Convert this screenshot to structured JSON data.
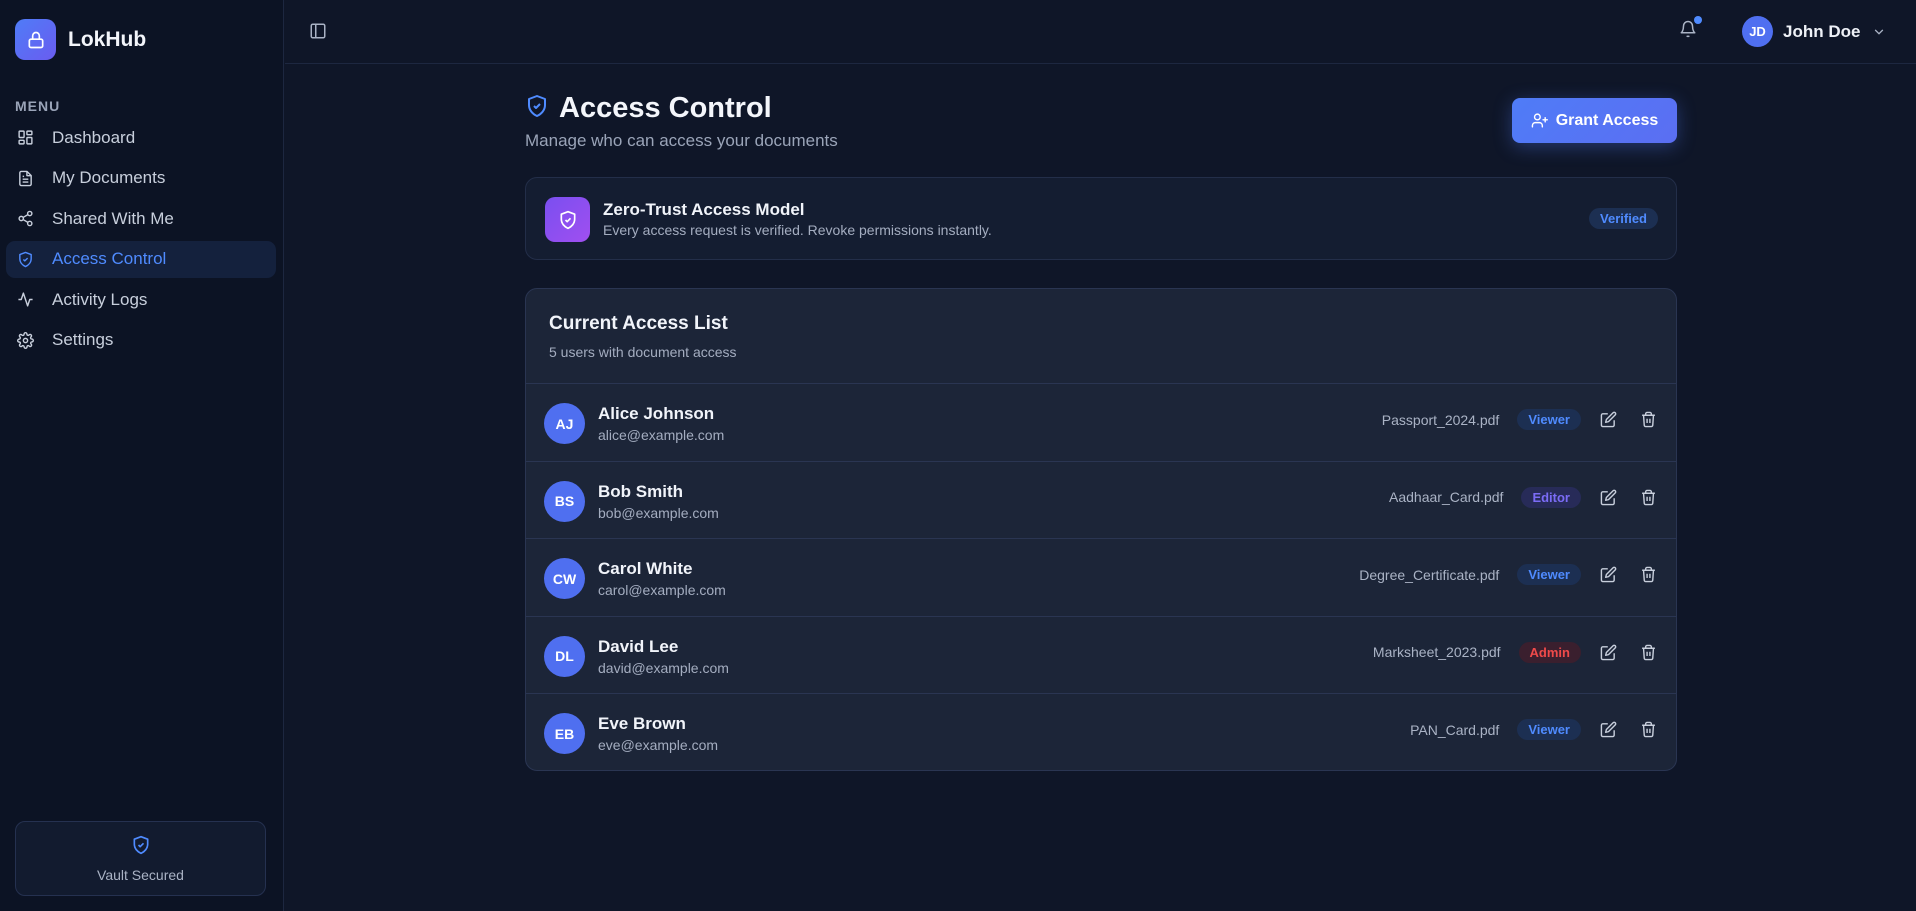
{
  "brand": {
    "name": "LokHub"
  },
  "sidebar": {
    "menu_title": "MENU",
    "items": [
      {
        "label": "Dashboard",
        "icon": "grid-icon"
      },
      {
        "label": "My Documents",
        "icon": "file-icon"
      },
      {
        "label": "Shared With Me",
        "icon": "share-icon"
      },
      {
        "label": "Access Control",
        "icon": "shield-check-icon",
        "active": true
      },
      {
        "label": "Activity Logs",
        "icon": "activity-icon"
      },
      {
        "label": "Settings",
        "icon": "gear-icon"
      }
    ],
    "vault_label": "Vault Secured"
  },
  "header": {
    "user": {
      "initials": "JD",
      "name": "John Doe"
    }
  },
  "page": {
    "title": "Access Control",
    "subtitle": "Manage who can access your documents",
    "grant_button": "Grant Access"
  },
  "zero_trust": {
    "title": "Zero-Trust Access Model",
    "description": "Every access request is verified. Revoke permissions instantly.",
    "badge": "Verified"
  },
  "access_list": {
    "title": "Current Access List",
    "subtitle": "5 users with document access",
    "rows": [
      {
        "initials": "AJ",
        "name": "Alice Johnson",
        "email": "alice@example.com",
        "document": "Passport_2024.pdf",
        "role": "Viewer"
      },
      {
        "initials": "BS",
        "name": "Bob Smith",
        "email": "bob@example.com",
        "document": "Aadhaar_Card.pdf",
        "role": "Editor"
      },
      {
        "initials": "CW",
        "name": "Carol White",
        "email": "carol@example.com",
        "document": "Degree_Certificate.pdf",
        "role": "Viewer"
      },
      {
        "initials": "DL",
        "name": "David Lee",
        "email": "david@example.com",
        "document": "Marksheet_2023.pdf",
        "role": "Admin"
      },
      {
        "initials": "EB",
        "name": "Eve Brown",
        "email": "eve@example.com",
        "document": "PAN_Card.pdf",
        "role": "Viewer"
      }
    ]
  },
  "colors": {
    "accent": "#4f8bff",
    "background": "#0f1628",
    "card": "#1c2538",
    "admin": "#ef4a4a",
    "editor": "#7b6cf6"
  }
}
